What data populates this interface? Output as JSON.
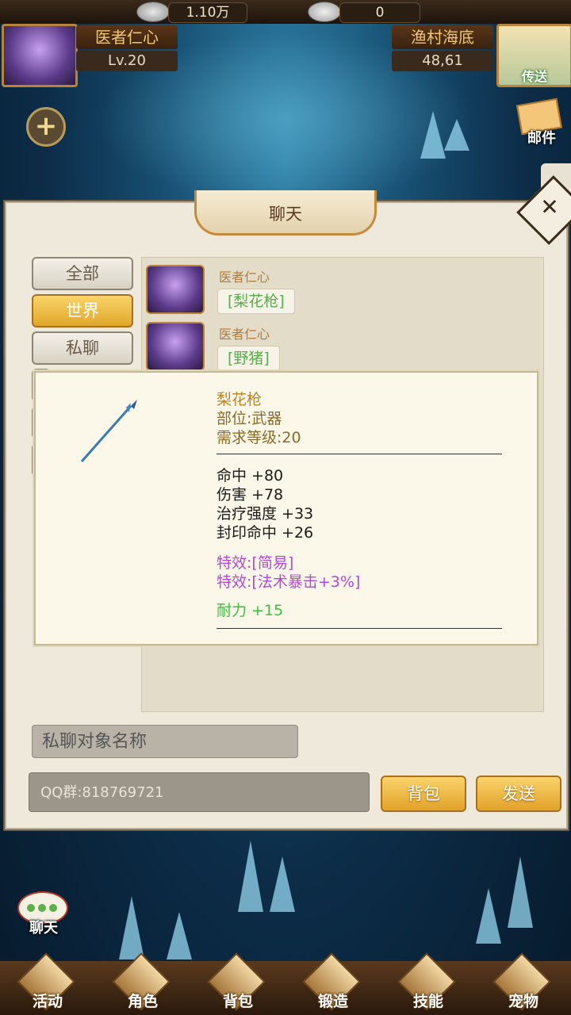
{
  "currency": {
    "silver": "1.10万",
    "gold": "0"
  },
  "player": {
    "name": "医者仁心",
    "level": "Lv.20"
  },
  "location": {
    "map": "渔村海底",
    "coords": "48,61",
    "teleport_label": "传送"
  },
  "hud": {
    "add_icon": "+",
    "mail_label": "邮件"
  },
  "chat_panel": {
    "title": "聊天",
    "categories": [
      "全部",
      "世界",
      "私聊"
    ],
    "active_category": "世界",
    "messages": [
      {
        "sender": "医者仁心",
        "text": "[梨花枪]"
      },
      {
        "sender": "医者仁心",
        "text": "[野猪]"
      }
    ],
    "private_target_placeholder": "私聊对象名称",
    "input_value": "QQ群:818769721",
    "bag_button": "背包",
    "send_button": "发送"
  },
  "item_tooltip": {
    "name": "梨花枪",
    "slot": "部位:武器",
    "level_req": "需求等级:20",
    "stats": [
      "命中 +80",
      "伤害 +78",
      "治疗强度 +33",
      "封印命中 +26"
    ],
    "effects": [
      "特效:[简易]",
      "特效:[法术暴击+3%]"
    ],
    "durability": "耐力 +15",
    "colors": {
      "name": "#b8842a",
      "req": "#8a6a2a",
      "stats": "#1a1a1a",
      "effects": "#b04ad0",
      "durability": "#3ac23a"
    }
  },
  "chat_float_label": "聊天",
  "bottom_nav": [
    "活动",
    "角色",
    "背包",
    "锻造",
    "技能",
    "宠物"
  ]
}
